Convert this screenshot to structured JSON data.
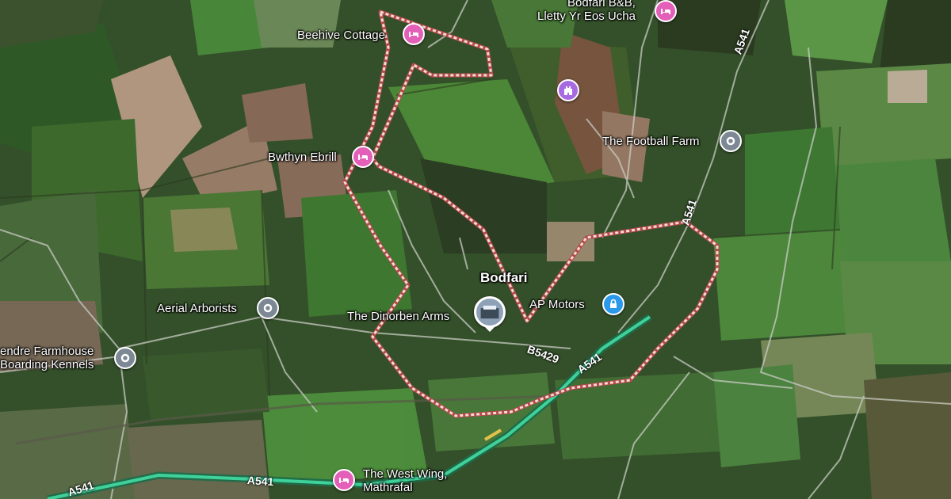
{
  "map": {
    "area_name": "Bodfari",
    "boundary_color": "#f3dcd8",
    "road_highlight_color": "#2fbf8a",
    "places": [
      {
        "id": "bodfari-bb",
        "label": "Bodfari B&B,",
        "label2": "Lletty Yr Eos Ucha",
        "icon": "bed-icon",
        "color": "#e45fb7"
      },
      {
        "id": "beehive-cottage",
        "label": "Beehive Cottage",
        "icon": "bed-icon",
        "color": "#e45fb7"
      },
      {
        "id": "bwthyn-ebrill",
        "label": "Bwthyn Ebrill",
        "icon": "bed-icon",
        "color": "#e45fb7"
      },
      {
        "id": "football-farm",
        "label": "The Football Farm",
        "icon": "pin-dot-icon",
        "color": "#7d8895"
      },
      {
        "id": "aerial-arborists",
        "label": "Aerial Arborists",
        "icon": "pin-dot-icon",
        "color": "#7d8895"
      },
      {
        "id": "farmhouse-kennels",
        "label": "endre Farmhouse",
        "label2": "Boarding Kennels",
        "icon": "pin-dot-icon",
        "color": "#7d8895"
      },
      {
        "id": "dinorben-arms",
        "label": "The Dinorben Arms",
        "icon": "photo-thumbnail-icon",
        "color": "#8ea2b7"
      },
      {
        "id": "ap-motors",
        "label": "AP Motors",
        "icon": "lock-icon",
        "color": "#2b98e9"
      },
      {
        "id": "west-wing",
        "label": "The West Wing,",
        "label2": "Mathrafal",
        "icon": "bed-icon",
        "color": "#e45fb7"
      },
      {
        "id": "castle",
        "label": "",
        "icon": "castle-icon",
        "color": "#a86ae0"
      }
    ],
    "roads": [
      {
        "id": "a541-top",
        "label": "A541"
      },
      {
        "id": "a541-right",
        "label": "A541"
      },
      {
        "id": "b5429",
        "label": "B5429"
      },
      {
        "id": "a541-mid",
        "label": "A541"
      },
      {
        "id": "a541-bottom",
        "label": "A541"
      },
      {
        "id": "a541-bottom-left",
        "label": "A541"
      }
    ]
  }
}
